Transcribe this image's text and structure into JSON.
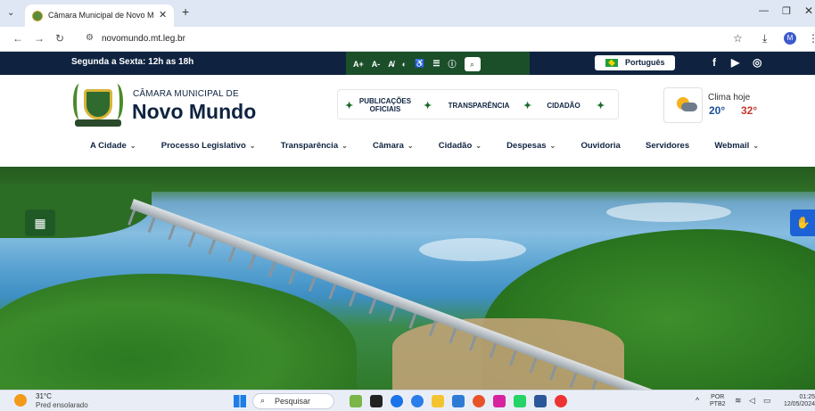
{
  "browser": {
    "tab_title": "Câmara Municipal de Novo Mu",
    "url": "novomundo.mt.leg.br",
    "profile_initial": "M"
  },
  "topbar": {
    "hours": "Segunda a Sexta: 12h as 18h",
    "a11y": [
      "A+",
      "A-",
      "A̸",
      "◐",
      "♿",
      "☰",
      "ⓘ"
    ],
    "language": "Português"
  },
  "header": {
    "org_small": "CÂMARA MUNICIPAL DE",
    "org_big": "Novo Mundo",
    "quick_links": [
      {
        "line1": "PUBLICAÇÕES",
        "line2": "OFICIAIS"
      },
      {
        "line1": "TRANSPARÊNCIA",
        "line2": ""
      },
      {
        "line1": "CIDADÃO",
        "line2": ""
      }
    ],
    "weather": {
      "label": "Clima hoje",
      "min": "20°",
      "max": "32°"
    }
  },
  "menu": [
    {
      "label": "A Cidade",
      "dropdown": true
    },
    {
      "label": "Processo Legislativo",
      "dropdown": true
    },
    {
      "label": "Transparência",
      "dropdown": true
    },
    {
      "label": "Câmara",
      "dropdown": true
    },
    {
      "label": "Cidadão",
      "dropdown": true
    },
    {
      "label": "Despesas",
      "dropdown": true
    },
    {
      "label": "Ouvidoria",
      "dropdown": false
    },
    {
      "label": "Servidores",
      "dropdown": false
    },
    {
      "label": "Webmail",
      "dropdown": true
    }
  ],
  "taskbar": {
    "weather_temp": "31°C",
    "weather_desc": "Pred ensolarado",
    "search": "Pesquisar",
    "lang_top": "POR",
    "lang_bottom": "PTB2",
    "time": "01:25",
    "date": "12/05/2024"
  },
  "colors": {
    "navy": "#0f2340",
    "green": "#1b4f2a",
    "accent_blue": "#1a62d6"
  }
}
